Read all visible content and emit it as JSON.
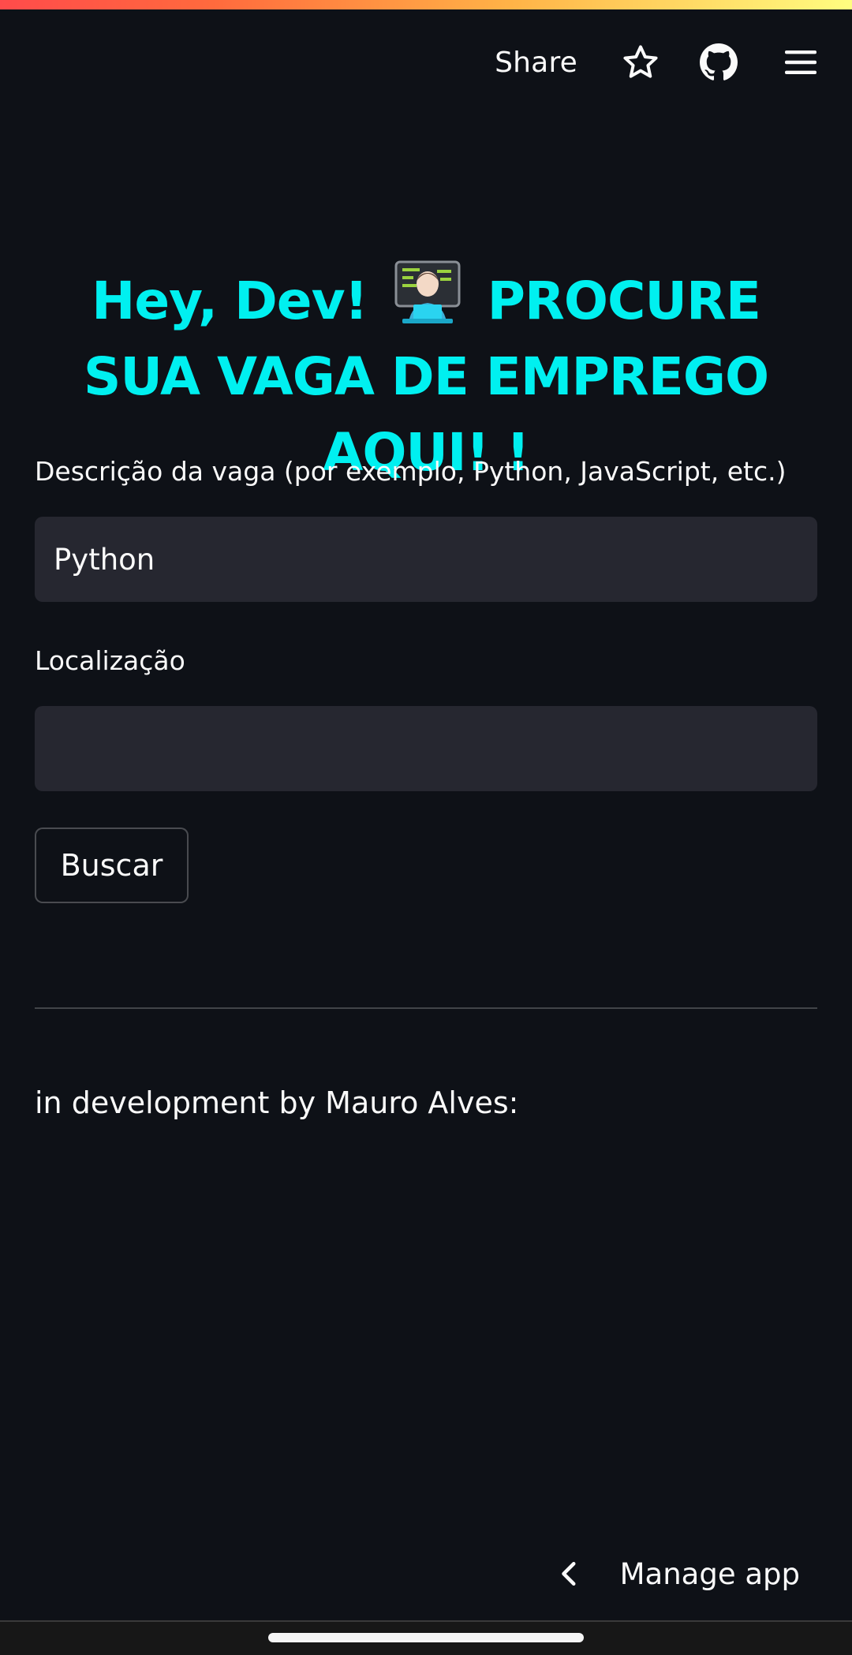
{
  "header": {
    "share_label": "Share",
    "icons": [
      "star-icon",
      "github-icon",
      "menu-icon"
    ]
  },
  "main": {
    "title_part1": "Hey, Dev!",
    "title_emoji": "technologist-emoji",
    "title_part2": "PROCURE SUA VAGA DE EMPREGO AQUI! !",
    "job_field": {
      "label": "Descrição da vaga (por exemplo, Python, JavaScript, etc.)",
      "value": "Python"
    },
    "location_field": {
      "label": "Localização",
      "value": ""
    },
    "search_button_label": "Buscar",
    "footer_credit": "in development by Mauro Alves:"
  },
  "bottom": {
    "manage_label": "Manage app"
  },
  "colors": {
    "background": "#0e1117",
    "title_accent": "#00f0f0",
    "input_background": "#262730"
  }
}
